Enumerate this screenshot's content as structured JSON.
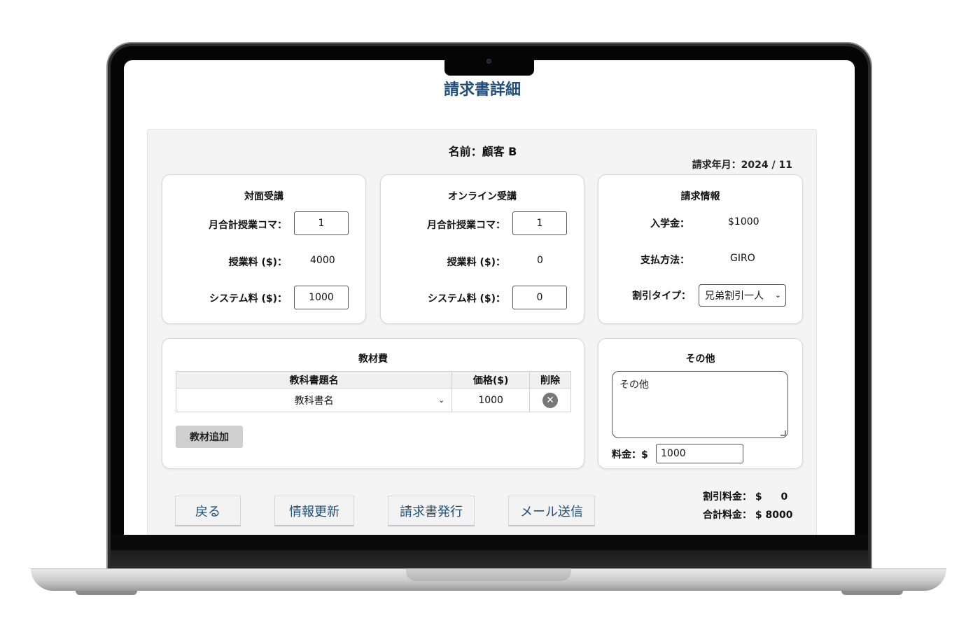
{
  "title": "請求書詳細",
  "customer": {
    "name_line": "名前：顧客 B"
  },
  "billing_month": "請求年月：2024 / 11",
  "in_person": {
    "title": "対面受講",
    "lessons_label": "月合計授業コマ：",
    "lessons_value": "1",
    "tuition_label": "授業料 ($)：",
    "tuition_value": "4000",
    "system_fee_label": "システム料 ($)：",
    "system_fee_value": "1000"
  },
  "online": {
    "title": "オンライン受講",
    "lessons_label": "月合計授業コマ：",
    "lessons_value": "1",
    "tuition_label": "授業料 ($)：",
    "tuition_value": "0",
    "system_fee_label": "システム料 ($)：",
    "system_fee_value": "0"
  },
  "billing_info": {
    "title": "請求情報",
    "admission_label": "入学金：",
    "admission_value": "$1000",
    "payment_label": "支払方法：",
    "payment_value": "GIRO",
    "discount_label": "割引タイプ：",
    "discount_value": "兄弟割引一人"
  },
  "materials": {
    "title": "教材費",
    "columns": [
      "教科書題名",
      "価格($)",
      "削除"
    ],
    "rows": [
      {
        "textbook": "教科書名",
        "price": "1000"
      }
    ],
    "add_label": "教材追加"
  },
  "other": {
    "title": "その他",
    "note_placeholder": "その他",
    "fee_label": "料金：$",
    "fee_value": "1000"
  },
  "actions": {
    "back": "戻る",
    "update": "情報更新",
    "issue": "請求書発行",
    "email": "メール送信"
  },
  "totals": {
    "discount_label": "割引料金：",
    "discount_currency": "$",
    "discount_value": "0",
    "total_label": "合計料金：",
    "total_value": "$ 8000"
  },
  "colors": {
    "title": "#1f4e79",
    "button_text": "#1f4e79",
    "panel_bg": "#f4f4f4"
  },
  "icons": [
    "chevron-down-icon",
    "delete-circle-icon",
    "resize-handle-icon",
    "camera-icon"
  ]
}
